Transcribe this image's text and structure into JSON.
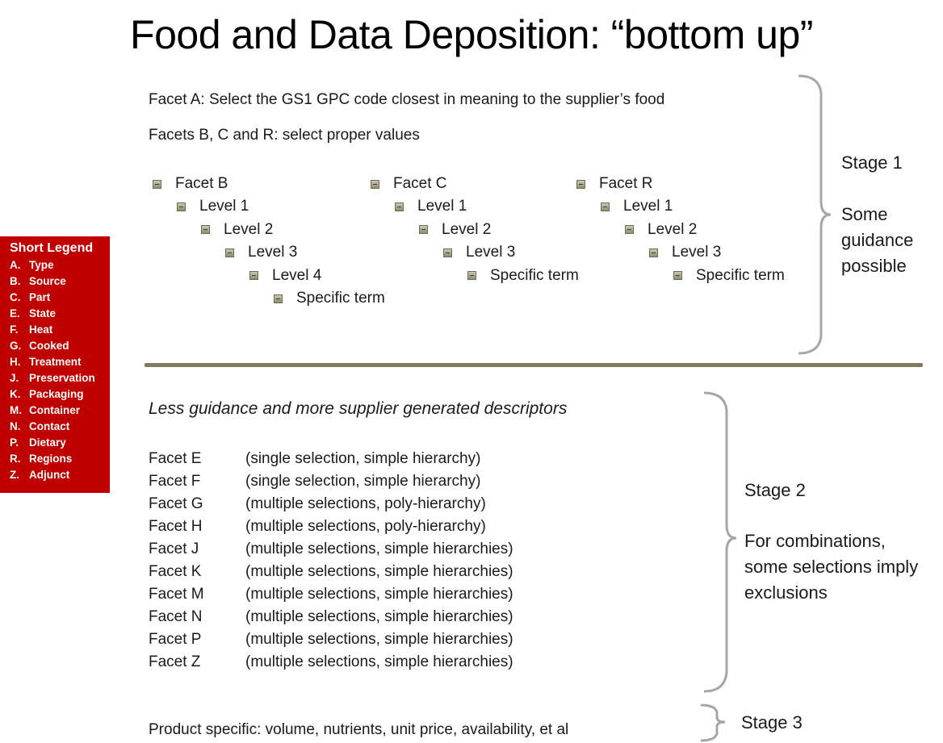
{
  "title": "Food and Data Deposition: “bottom up”",
  "stage1": {
    "facet_a_instruction": "Facet A: Select the GS1 GPC code closest in meaning to the supplier’s food",
    "facets_bcr_instruction": "Facets B, C and R: select proper values",
    "trees": [
      {
        "name": "Facet B",
        "levels": [
          "Level 1",
          "Level 2",
          "Level 3",
          "Level 4",
          "Specific term"
        ]
      },
      {
        "name": "Facet C",
        "levels": [
          "Level 1",
          "Level 2",
          "Level 3",
          "Specific term"
        ]
      },
      {
        "name": "Facet R",
        "levels": [
          "Level 1",
          "Level 2",
          "Level 3",
          "Specific term"
        ]
      }
    ],
    "label": "Stage 1",
    "note_lines": [
      "Some",
      "guidance",
      "possible"
    ]
  },
  "legend": {
    "title": "Short Legend",
    "items": [
      {
        "key": "A.",
        "label": "Type"
      },
      {
        "key": "B.",
        "label": "Source"
      },
      {
        "key": "C.",
        "label": "Part"
      },
      {
        "key": "E.",
        "label": "State"
      },
      {
        "key": "F.",
        "label": "Heat"
      },
      {
        "key": "G.",
        "label": "Cooked"
      },
      {
        "key": "H.",
        "label": "Treatment"
      },
      {
        "key": "J.",
        "label": "Preservation"
      },
      {
        "key": "K.",
        "label": "Packaging"
      },
      {
        "key": "M.",
        "label": "Container"
      },
      {
        "key": "N.",
        "label": "Contact"
      },
      {
        "key": "P.",
        "label": "Dietary"
      },
      {
        "key": "R.",
        "label": "Regions"
      },
      {
        "key": "Z.",
        "label": "Adjunct"
      }
    ],
    "background_color": "#c00000"
  },
  "stage2": {
    "heading": "Less guidance and more supplier generated descriptors",
    "facets": [
      {
        "name": "Facet E",
        "desc": "(single selection, simple hierarchy)"
      },
      {
        "name": "Facet F",
        "desc": "(single selection, simple hierarchy)"
      },
      {
        "name": "Facet G",
        "desc": "(multiple selections, poly-hierarchy)"
      },
      {
        "name": "Facet H",
        "desc": "(multiple selections, poly-hierarchy)"
      },
      {
        "name": "Facet J",
        "desc": "(multiple selections, simple hierarchies)"
      },
      {
        "name": "Facet K",
        "desc": "(multiple selections, simple hierarchies)"
      },
      {
        "name": "Facet M",
        "desc": "(multiple selections, simple hierarchies)"
      },
      {
        "name": "Facet N",
        "desc": "(multiple selections, simple hierarchies)"
      },
      {
        "name": "Facet P",
        "desc": "(multiple selections, simple hierarchies)"
      },
      {
        "name": "Facet Z",
        "desc": "(multiple selections, simple hierarchies)"
      }
    ],
    "label": "Stage 2",
    "note_lines": [
      "For combinations,",
      "some selections imply",
      "exclusions"
    ]
  },
  "stage3": {
    "text": "Product specific: volume, nutrients, unit price, availability, et al",
    "label": "Stage 3"
  },
  "colors": {
    "divider": "#7f7b5e",
    "brace": "#a6a6a6"
  }
}
